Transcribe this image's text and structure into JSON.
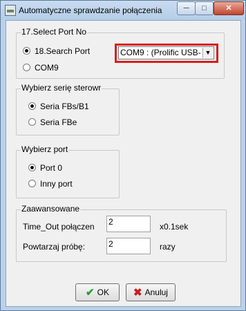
{
  "window": {
    "title": "Automatyczne sprawdzanie połączenia",
    "controls": {
      "minimize": "─",
      "maximize": "□",
      "close": "✕"
    }
  },
  "port_select": {
    "legend": "17.Select Port No",
    "options": [
      "18.Search Port",
      "COM9"
    ],
    "selected": "18.Search Port",
    "combo_value": "COM9 : (Prolific USB-",
    "combo_arrow": "▼",
    "highlight_color": "#d81e1e"
  },
  "series": {
    "legend": "Wybierz serię sterowr",
    "options": [
      "Seria FBs/B1",
      "Seria FBe"
    ],
    "selected": "Seria FBs/B1"
  },
  "port": {
    "legend": "Wybierz port",
    "options": [
      "Port 0",
      "Inny port"
    ],
    "selected": "Port 0"
  },
  "advanced": {
    "legend": "Zaawansowane",
    "timeout_label": "Time_Out połączen",
    "timeout_value": "2",
    "timeout_unit": "x0.1sek",
    "retry_label": "Powtarzaj próbę:",
    "retry_value": "2",
    "retry_unit": "razy"
  },
  "buttons": {
    "ok_icon": "✔",
    "ok": "OK",
    "cancel_icon": "✖",
    "cancel": "Anuluj"
  }
}
